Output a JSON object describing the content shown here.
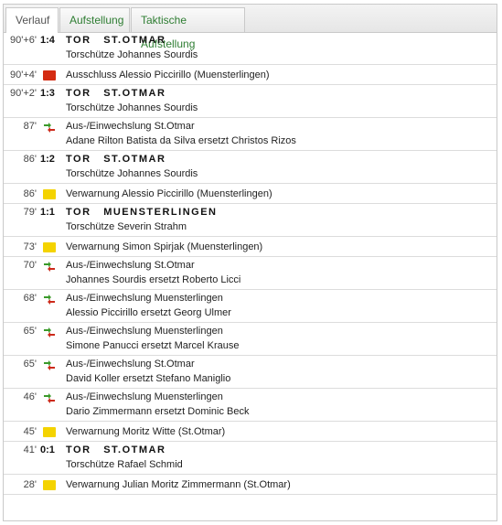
{
  "tabs": [
    "Verlauf",
    "Aufstellung",
    "Taktische Aufstellung"
  ],
  "events": [
    {
      "minute": "90'+6'",
      "type": "goal",
      "score": "1:4",
      "title": "TOR   ST.OTMAR",
      "line2": "Torschütze Johannes Sourdis"
    },
    {
      "minute": "90'+4'",
      "type": "red",
      "line1": "Ausschluss Alessio Piccirillo (Muensterlingen)"
    },
    {
      "minute": "90'+2'",
      "type": "goal",
      "score": "1:3",
      "title": "TOR   ST.OTMAR",
      "line2": "Torschütze Johannes Sourdis"
    },
    {
      "minute": "87'",
      "type": "sub",
      "line1": "Aus-/Einwechslung St.Otmar",
      "line2": "Adane Rilton Batista da Silva ersetzt Christos Rizos"
    },
    {
      "minute": "86'",
      "type": "goal",
      "score": "1:2",
      "title": "TOR   ST.OTMAR",
      "line2": "Torschütze Johannes Sourdis"
    },
    {
      "minute": "86'",
      "type": "yellow",
      "line1": "Verwarnung Alessio Piccirillo (Muensterlingen)"
    },
    {
      "minute": "79'",
      "type": "goal",
      "score": "1:1",
      "title": "TOR   MUENSTERLINGEN",
      "line2": "Torschütze Severin Strahm"
    },
    {
      "minute": "73'",
      "type": "yellow",
      "line1": "Verwarnung Simon Spirjak (Muensterlingen)"
    },
    {
      "minute": "70'",
      "type": "sub",
      "line1": "Aus-/Einwechslung St.Otmar",
      "line2": "Johannes Sourdis ersetzt Roberto Licci"
    },
    {
      "minute": "68'",
      "type": "sub",
      "line1": "Aus-/Einwechslung Muensterlingen",
      "line2": "Alessio Piccirillo ersetzt Georg Ulmer"
    },
    {
      "minute": "65'",
      "type": "sub",
      "line1": "Aus-/Einwechslung Muensterlingen",
      "line2": "Simone Panucci ersetzt Marcel Krause"
    },
    {
      "minute": "65'",
      "type": "sub",
      "line1": "Aus-/Einwechslung St.Otmar",
      "line2": "David Koller ersetzt Stefano Maniglio"
    },
    {
      "minute": "46'",
      "type": "sub",
      "line1": "Aus-/Einwechslung Muensterlingen",
      "line2": "Dario Zimmermann ersetzt Dominic Beck"
    },
    {
      "minute": "45'",
      "type": "yellow",
      "line1": "Verwarnung Moritz Witte (St.Otmar)"
    },
    {
      "minute": "41'",
      "type": "goal",
      "score": "0:1",
      "title": "TOR   ST.OTMAR",
      "line2": "Torschütze Rafael Schmid"
    },
    {
      "minute": "28'",
      "type": "yellow",
      "line1": "Verwarnung Julian Moritz Zimmermann (St.Otmar)"
    }
  ]
}
